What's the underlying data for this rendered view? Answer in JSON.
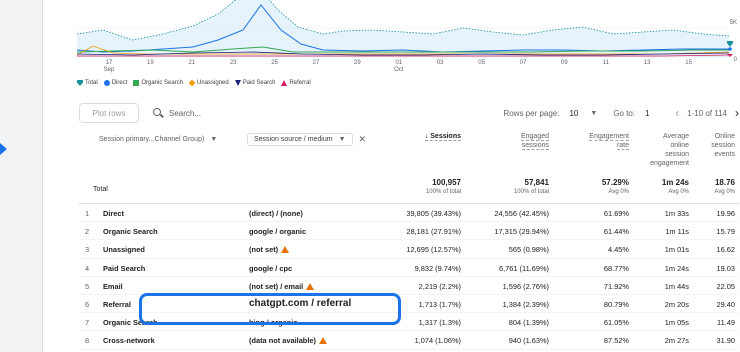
{
  "chart_data": {
    "type": "line",
    "x_tick_labels": [
      [
        "17",
        "Sep"
      ],
      [
        "19",
        ""
      ],
      [
        "21",
        ""
      ],
      [
        "23",
        ""
      ],
      [
        "25",
        ""
      ],
      [
        "27",
        ""
      ],
      [
        "29",
        ""
      ],
      [
        "01",
        "Oct"
      ],
      [
        "03",
        ""
      ],
      [
        "05",
        ""
      ],
      [
        "07",
        ""
      ],
      [
        "09",
        ""
      ],
      [
        "11",
        ""
      ],
      [
        "13",
        ""
      ],
      [
        "15",
        ""
      ]
    ],
    "y_tick_labels": [
      "5K",
      "0"
    ],
    "legend": [
      {
        "name": "Total",
        "symbol": "pin",
        "color": "#12939a"
      },
      {
        "name": "Direct",
        "symbol": "dot",
        "color": "#1a73e8"
      },
      {
        "name": "Organic Search",
        "symbol": "square",
        "color": "#34a853"
      },
      {
        "name": "Unassigned",
        "symbol": "diamond",
        "color": "#f29900"
      },
      {
        "name": "Paid Search",
        "symbol": "tri-down",
        "color": "#1a237e"
      },
      {
        "name": "Referral",
        "symbol": "tri-up",
        "color": "#d81b60"
      }
    ]
  },
  "toolbar": {
    "plot_rows": "Plot rows",
    "search_placeholder": "Search...",
    "rows_per_page_label": "Rows per page:",
    "rows_per_page": "10",
    "goto_label": "Go to:",
    "goto_value": "1",
    "page_range": "1-10 of 114"
  },
  "header": {
    "dim1": "Session primary...Channel Group)",
    "dim2": "Session source / medium",
    "sessions": "↓ Sessions",
    "engaged": [
      "Engaged",
      "sessions"
    ],
    "engagement_rate": [
      "Engagement",
      "rate"
    ],
    "avg": [
      "Average",
      "online",
      "session",
      "engagement"
    ],
    "online": [
      "Online",
      "session",
      "events"
    ]
  },
  "total": {
    "label": "Total",
    "sessions": "100,957",
    "sessions_sub": "100% of total",
    "engaged": "57,841",
    "engaged_sub": "100% of total",
    "rate": "57.29%",
    "rate_sub": "Avg 0%",
    "avg": "1m 24s",
    "avg_sub": "Avg 0%",
    "events": "18.76",
    "events_sub": "Avg 0%"
  },
  "rows": [
    {
      "n": "1",
      "channel": "Direct",
      "source": "(direct) / (none)",
      "sessions": "39,805 (39.43%)",
      "engaged": "24,556 (42.45%)",
      "rate": "61.69%",
      "avg": "1m 33s",
      "events": "19.96",
      "warn": false
    },
    {
      "n": "2",
      "channel": "Organic Search",
      "source": "google / organic",
      "sessions": "28,181 (27.91%)",
      "engaged": "17,315 (29.94%)",
      "rate": "61.44%",
      "avg": "1m 11s",
      "events": "15.79",
      "warn": false
    },
    {
      "n": "3",
      "channel": "Unassigned",
      "source": "(not set)",
      "sessions": "12,695 (12.57%)",
      "engaged": "565 (0.98%)",
      "rate": "4.45%",
      "avg": "1m 01s",
      "events": "16.62",
      "warn": true
    },
    {
      "n": "4",
      "channel": "Paid Search",
      "source": "google / cpc",
      "sessions": "9,832 (9.74%)",
      "engaged": "6,761 (11.69%)",
      "rate": "68.77%",
      "avg": "1m 24s",
      "events": "19.03",
      "warn": false
    },
    {
      "n": "5",
      "channel": "Email",
      "source": "(not set) / email",
      "sessions": "2,219 (2.2%)",
      "engaged": "1,596 (2.76%)",
      "rate": "71.92%",
      "avg": "1m 44s",
      "events": "22.05",
      "warn": true
    },
    {
      "n": "6",
      "channel": "Referral",
      "source": "chatgpt.com / referral",
      "sessions": "1,713 (1.7%)",
      "engaged": "1,384 (2.39%)",
      "rate": "80.79%",
      "avg": "2m 20s",
      "events": "29.40",
      "warn": false
    },
    {
      "n": "7",
      "channel": "Organic Search",
      "source": "bing / organic",
      "sessions": "1,317 (1.3%)",
      "engaged": "804 (1.39%)",
      "rate": "61.05%",
      "avg": "1m 05s",
      "events": "11.49",
      "warn": false
    },
    {
      "n": "8",
      "channel": "Cross-network",
      "source": "(data not available)",
      "sessions": "1,074 (1.06%)",
      "engaged": "940 (1.63%)",
      "rate": "87.52%",
      "avg": "2m 27s",
      "events": "31.90",
      "warn": true
    }
  ]
}
